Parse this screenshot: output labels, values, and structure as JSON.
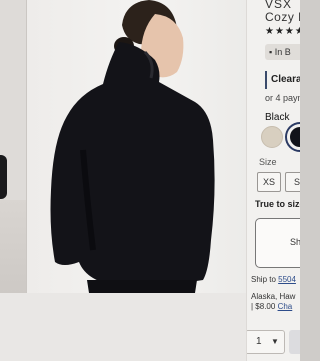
{
  "product": {
    "brand": "VSX",
    "name": "Cozy F",
    "rating_stars": "★★★★",
    "stock_text": "In B",
    "promo_badge": "Clearan",
    "payment_text": "or 4 paym",
    "selected_color": "Black",
    "colors": [
      {
        "name": "cream",
        "hex": "#d8cfc0"
      },
      {
        "name": "black",
        "hex": "#12131a",
        "selected": true
      }
    ],
    "size_label": "Size",
    "sizes": [
      "XS",
      "S"
    ],
    "fit_label": "True to size",
    "ship_option_label": "Sh",
    "ship_to_prefix": "Ship to",
    "ship_to_zip": "5504",
    "region_text": "Alaska, Haw",
    "fee_text": "| $8.00",
    "change_link": "Cha",
    "quantity": "1"
  },
  "colors": {
    "accent": "#2b3a63",
    "link": "#2d4c8a",
    "jacket": "#131318"
  }
}
